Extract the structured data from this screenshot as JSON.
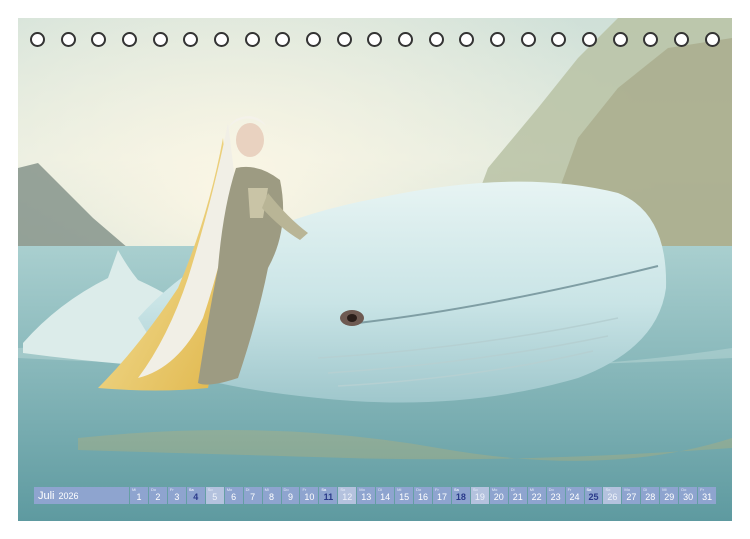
{
  "calendar": {
    "month": "Juli",
    "year": "2026",
    "days": [
      {
        "d": "1",
        "wd": "Mi",
        "type": "normal"
      },
      {
        "d": "2",
        "wd": "Do",
        "type": "normal"
      },
      {
        "d": "3",
        "wd": "Fr",
        "type": "normal"
      },
      {
        "d": "4",
        "wd": "Sa",
        "type": "highlight"
      },
      {
        "d": "5",
        "wd": "So",
        "type": "weekend"
      },
      {
        "d": "6",
        "wd": "Mo",
        "type": "normal"
      },
      {
        "d": "7",
        "wd": "Di",
        "type": "normal"
      },
      {
        "d": "8",
        "wd": "Mi",
        "type": "normal"
      },
      {
        "d": "9",
        "wd": "Do",
        "type": "normal"
      },
      {
        "d": "10",
        "wd": "Fr",
        "type": "normal"
      },
      {
        "d": "11",
        "wd": "Sa",
        "type": "highlight"
      },
      {
        "d": "12",
        "wd": "So",
        "type": "weekend"
      },
      {
        "d": "13",
        "wd": "Mo",
        "type": "normal"
      },
      {
        "d": "14",
        "wd": "Di",
        "type": "normal"
      },
      {
        "d": "15",
        "wd": "Mi",
        "type": "normal"
      },
      {
        "d": "16",
        "wd": "Do",
        "type": "normal"
      },
      {
        "d": "17",
        "wd": "Fr",
        "type": "normal"
      },
      {
        "d": "18",
        "wd": "Sa",
        "type": "highlight"
      },
      {
        "d": "19",
        "wd": "So",
        "type": "weekend"
      },
      {
        "d": "20",
        "wd": "Mo",
        "type": "normal"
      },
      {
        "d": "21",
        "wd": "Di",
        "type": "normal"
      },
      {
        "d": "22",
        "wd": "Mi",
        "type": "normal"
      },
      {
        "d": "23",
        "wd": "Do",
        "type": "normal"
      },
      {
        "d": "24",
        "wd": "Fr",
        "type": "normal"
      },
      {
        "d": "25",
        "wd": "Sa",
        "type": "highlight"
      },
      {
        "d": "26",
        "wd": "So",
        "type": "weekend"
      },
      {
        "d": "27",
        "wd": "Mo",
        "type": "normal"
      },
      {
        "d": "28",
        "wd": "Di",
        "type": "normal"
      },
      {
        "d": "29",
        "wd": "Mi",
        "type": "normal"
      },
      {
        "d": "30",
        "wd": "Do",
        "type": "normal"
      },
      {
        "d": "31",
        "wd": "Fr",
        "type": "normal"
      }
    ]
  },
  "colors": {
    "strip": "#8ea4cf",
    "weekend": "#b4c2de",
    "highlight_text": "#2a3a8a",
    "ring": "#333333"
  },
  "icons": [
    "spiral-ring-icon"
  ]
}
